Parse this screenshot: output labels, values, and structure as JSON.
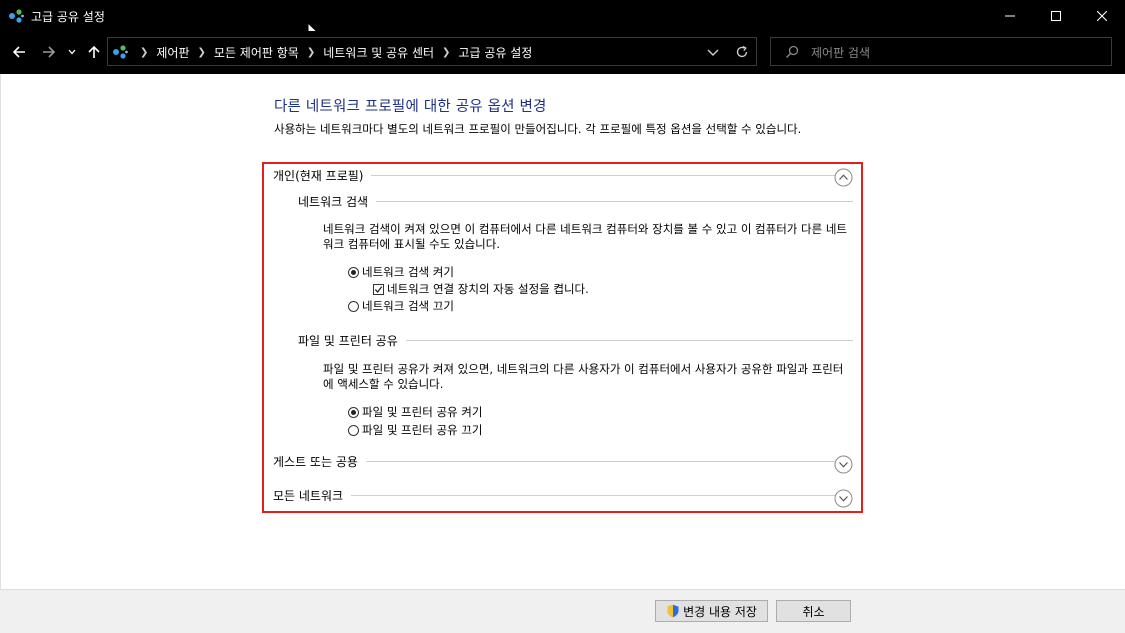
{
  "window": {
    "title": "고급 공유 설정"
  },
  "nav": {
    "breadcrumbs": [
      "제어판",
      "모든 제어판 항목",
      "네트워크 및 공유 센터",
      "고급 공유 설정"
    ],
    "search_placeholder": "제어판 검색"
  },
  "page": {
    "title": "다른 네트워크 프로필에 대한 공유 옵션 변경",
    "description": "사용하는 네트워크마다 별도의 네트워크 프로필이 만들어집니다. 각 프로필에 특정 옵션을 선택할 수 있습니다."
  },
  "profiles": {
    "private": {
      "label": "개인(현재 프로필)",
      "expanded": true,
      "network_discovery": {
        "heading": "네트워크 검색",
        "description": "네트워크 검색이 켜져 있으면 이 컴퓨터에서 다른 네트워크 컴퓨터와 장치를 볼 수 있고 이 컴퓨터가 다른 네트워크 컴퓨터에 표시될 수도 있습니다.",
        "option_on": "네트워크 검색 켜기",
        "auto_setup": "네트워크 연결 장치의 자동 설정을 켭니다.",
        "option_off": "네트워크 검색 끄기",
        "selected": "on",
        "auto_setup_checked": true
      },
      "file_printer_sharing": {
        "heading": "파일 및 프린터 공유",
        "description": "파일 및 프린터 공유가 켜져 있으면, 네트워크의 다른 사용자가 이 컴퓨터에서 사용자가 공유한 파일과 프린터에 액세스할 수 있습니다.",
        "option_on": "파일 및 프린터 공유 켜기",
        "option_off": "파일 및 프린터 공유 끄기",
        "selected": "on"
      }
    },
    "guest_public": {
      "label": "게스트 또는 공용",
      "expanded": false
    },
    "all_networks": {
      "label": "모든 네트워크",
      "expanded": false
    }
  },
  "footer": {
    "save_label": "변경 내용 저장",
    "cancel_label": "취소"
  },
  "colors": {
    "title_blue": "#1e3287",
    "highlight_red": "#e0201c"
  }
}
